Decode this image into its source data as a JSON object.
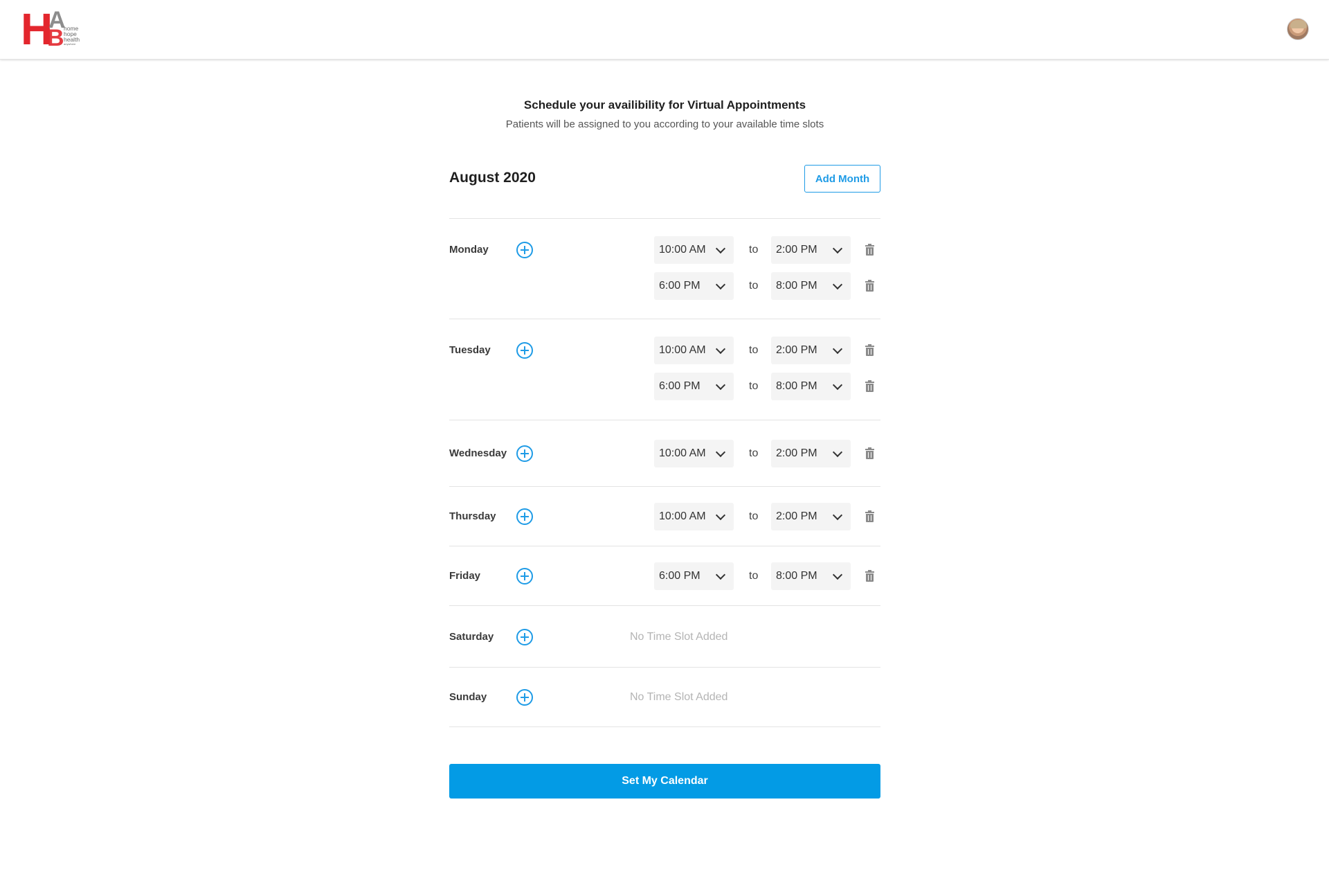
{
  "brand": {
    "logo_letters": [
      "H",
      "A",
      "B"
    ],
    "logo_words": [
      "home",
      "hope",
      "health",
      "anywhere"
    ],
    "colors": {
      "primary": "#e3262d",
      "secondary": "#8d8d8d"
    }
  },
  "user": {
    "avatar_icon": "user-avatar"
  },
  "header": {
    "title": "Schedule your availibility for Virtual Appointments",
    "subtitle": "Patients will be assigned to you according to your available time slots"
  },
  "calendar": {
    "month": "August 2020",
    "add_month_label": "Add Month",
    "to_label": "to",
    "empty_label": "No Time Slot Added",
    "days": [
      {
        "name": "Monday",
        "slots": [
          {
            "from": "10:00 AM",
            "to": "2:00 PM"
          },
          {
            "from": "6:00 PM",
            "to": "8:00 PM"
          }
        ]
      },
      {
        "name": "Tuesday",
        "slots": [
          {
            "from": "10:00 AM",
            "to": "2:00 PM"
          },
          {
            "from": "6:00 PM",
            "to": "8:00 PM"
          }
        ]
      },
      {
        "name": "Wednesday",
        "slots": [
          {
            "from": "10:00 AM",
            "to": "2:00 PM"
          }
        ]
      },
      {
        "name": "Thursday",
        "slots": [
          {
            "from": "10:00 AM",
            "to": "2:00 PM"
          }
        ]
      },
      {
        "name": "Friday",
        "slots": [
          {
            "from": "6:00 PM",
            "to": "8:00 PM"
          }
        ]
      },
      {
        "name": "Saturday",
        "slots": []
      },
      {
        "name": "Sunday",
        "slots": []
      }
    ],
    "submit_label": "Set My Calendar"
  },
  "accent_color": "#1e9be6",
  "button_color": "#039be5"
}
